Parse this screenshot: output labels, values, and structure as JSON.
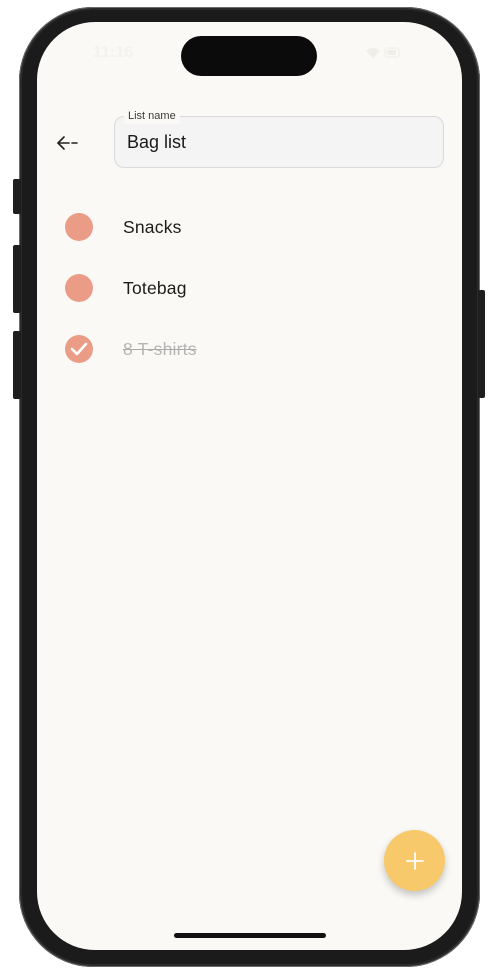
{
  "status_bar": {
    "time": "11:16"
  },
  "header": {
    "back_icon": "arrow-left-icon",
    "list_name_label": "List name",
    "list_name_value": "Bag list"
  },
  "items": [
    {
      "label": "Snacks",
      "checked": false
    },
    {
      "label": "Totebag",
      "checked": false
    },
    {
      "label": "8 T-shirts",
      "checked": true
    }
  ],
  "fab": {
    "icon": "plus-icon"
  },
  "colors": {
    "background": "#faf9f5",
    "accent": "#eb9c86",
    "fab": "#f7c96b"
  }
}
